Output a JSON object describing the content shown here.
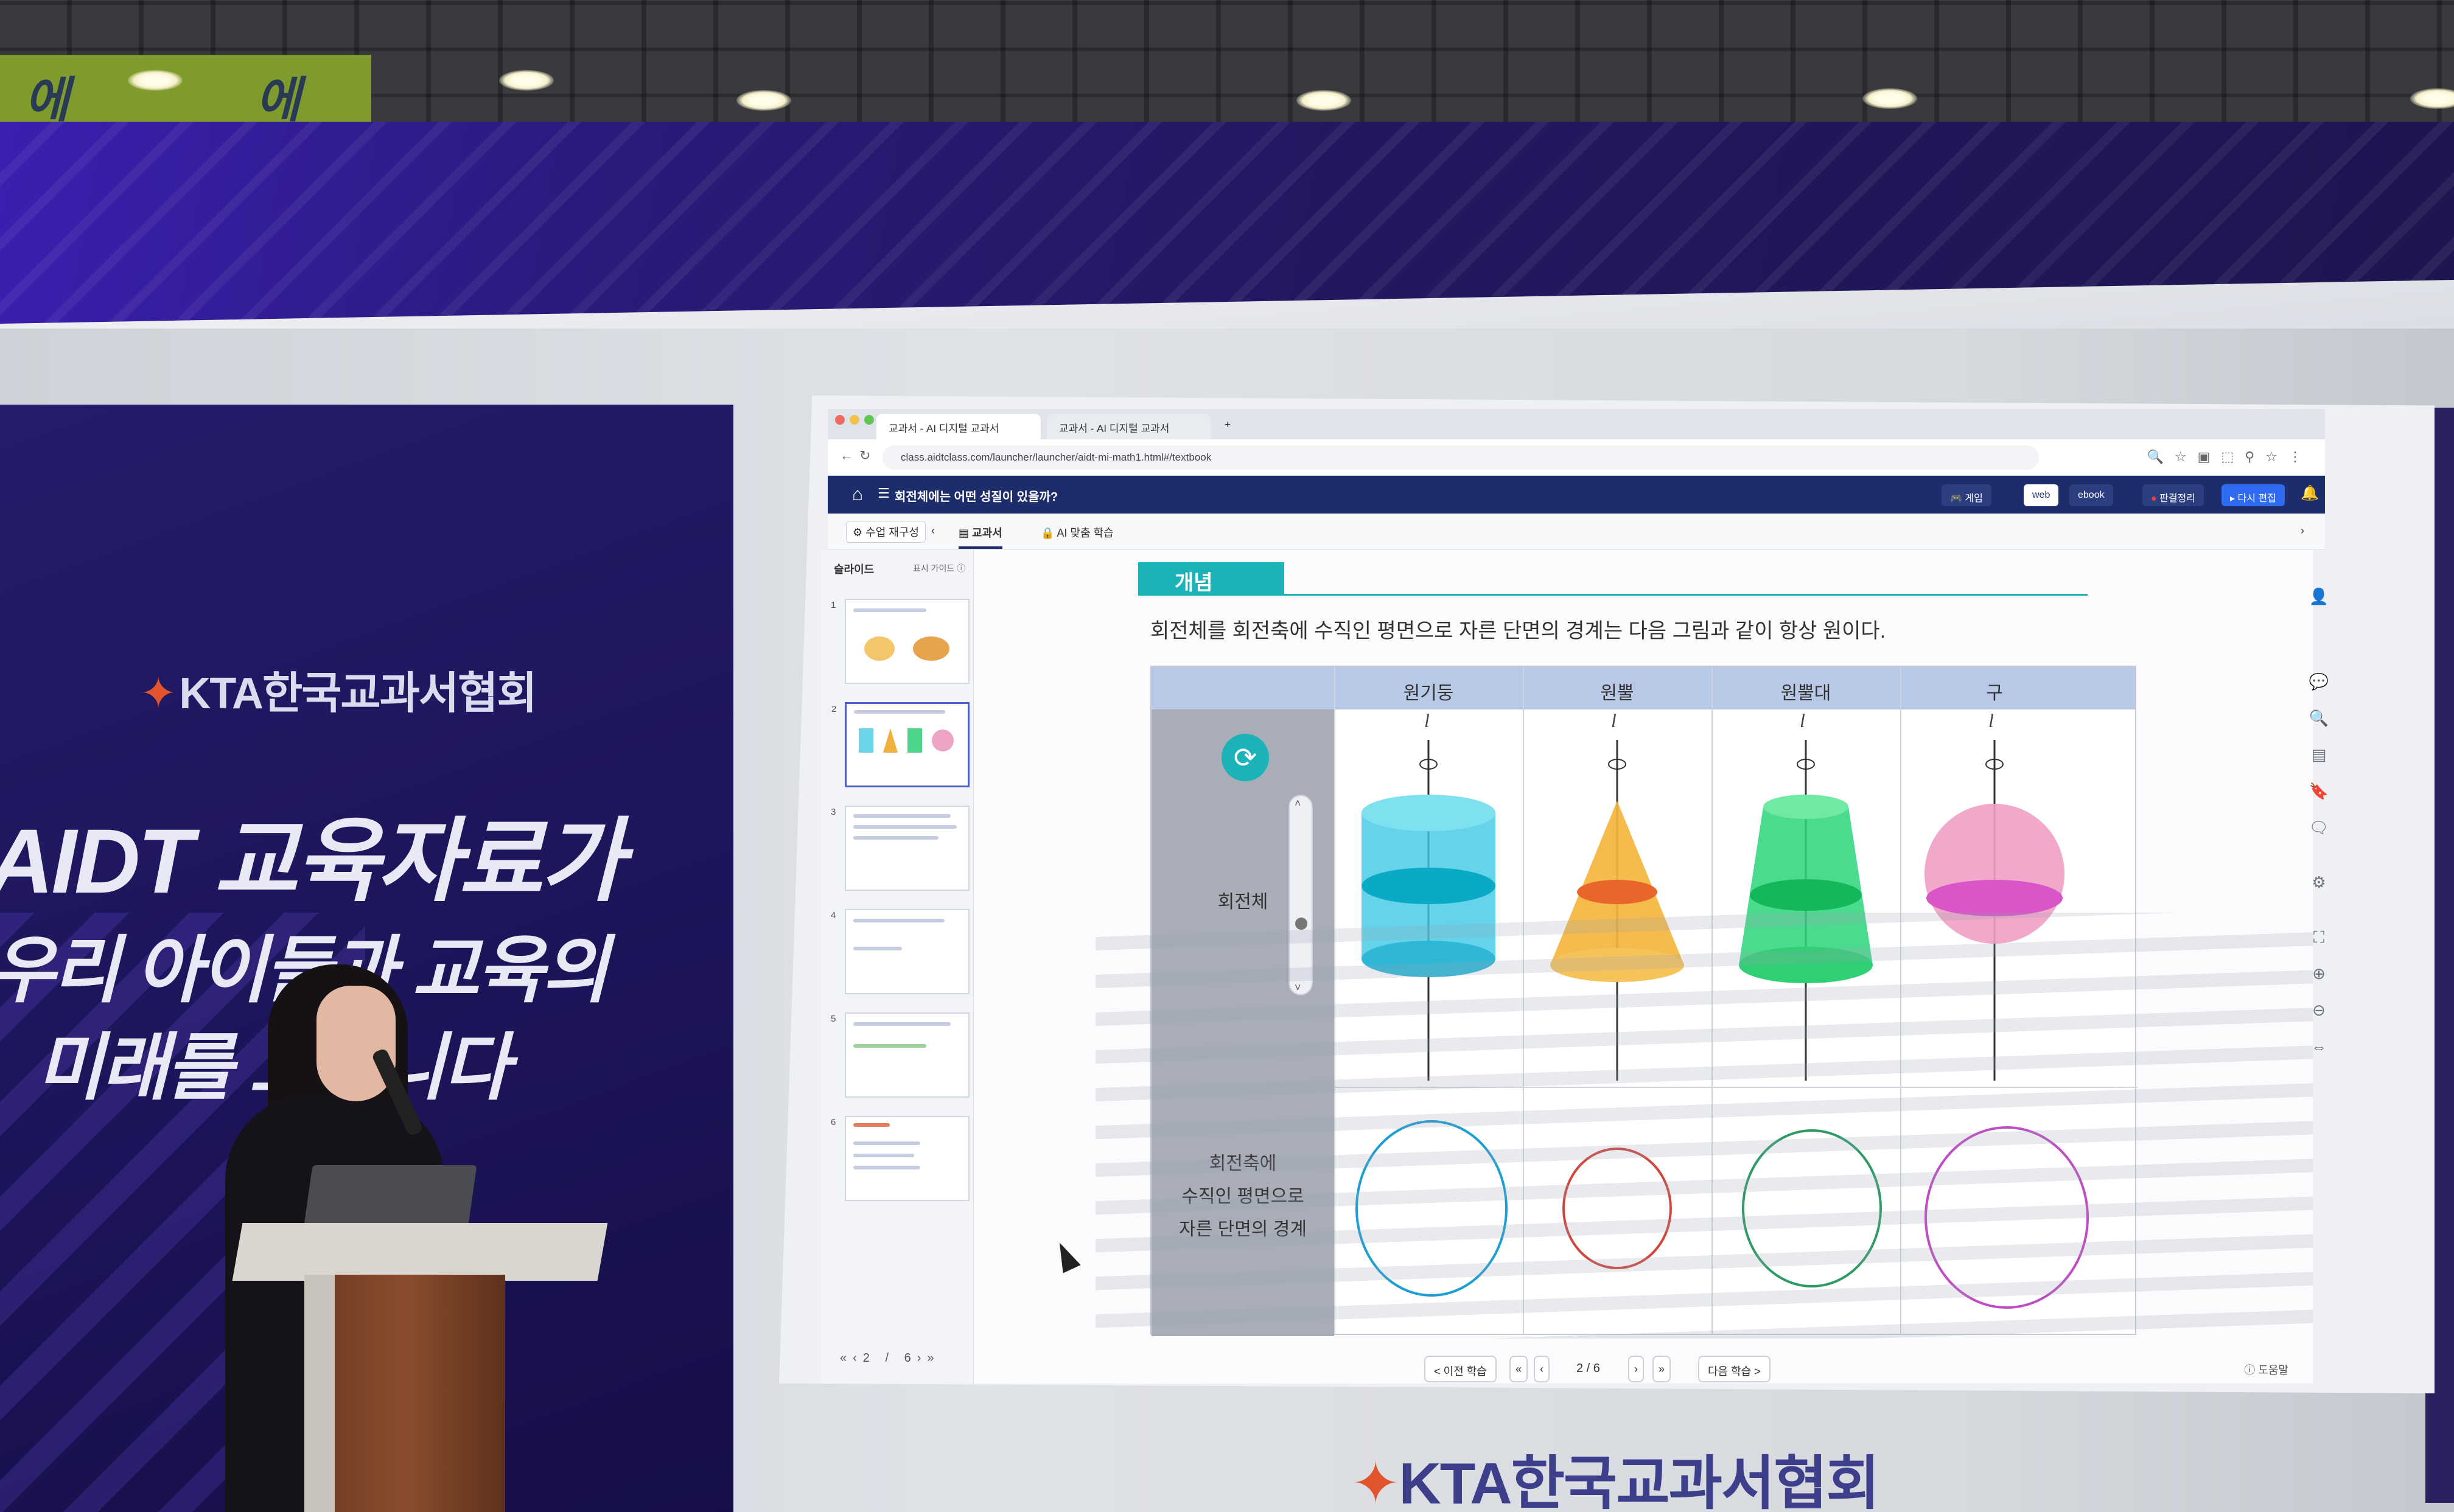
{
  "venue": {
    "ceiling_sign": [
      "에",
      "에"
    ],
    "banner": {
      "logo": "KTA한국교과서협회",
      "headline": [
        "AIDT 교육자료가",
        "우리 아이들과 교육의",
        "미래를 그립니다"
      ]
    },
    "bottom_logo": "KTA한국교과서협회"
  },
  "browser": {
    "tabs": [
      {
        "label": "교과서 - AI 디지털 교과서",
        "active": true
      },
      {
        "label": "교과서 - AI 디지털 교과서",
        "active": false
      }
    ],
    "new_tab": "+",
    "url": "class.aidtclass.com/launcher/launcher/aidt-mi-math1.html#/textbook"
  },
  "app": {
    "title": "회전체에는 어떤 성질이 있을까?",
    "header_buttons": {
      "game": "게임",
      "web": "web",
      "ebook": "ebook",
      "record": "판결정리",
      "replay": "다시 편집"
    },
    "subnav": {
      "class_reconfig": "수업 재구성",
      "textbook": "교과서",
      "ai_learning": "AI 맞춤 학습"
    },
    "slides": {
      "header": "슬라이드",
      "guide": "표시 가이드",
      "numbers": [
        "1",
        "2",
        "3",
        "4",
        "5",
        "6"
      ],
      "active_index": 2,
      "pager": "2 / 6"
    },
    "lesson": {
      "tag": "개념",
      "description": "회전체를 회전축에 수직인 평면으로 자른 단면의 경계는 다음 그림과 같이 항상 원이다.",
      "columns": [
        "원기둥",
        "원뿔",
        "원뿔대",
        "구"
      ],
      "axis_label": "l",
      "row_labels": {
        "solid": "회전체",
        "section": [
          "회전축에",
          "수직인 평면으로",
          "자른 단면의 경계"
        ]
      },
      "colors": {
        "cylinder": "#16b8d8",
        "cone": "#f0a52a",
        "frustum": "#22c96a",
        "sphere": "#e88ab6",
        "ring_cylinder": "#1a9fd0",
        "ring_cone": "#d2453a",
        "ring_frustum": "#2e9a64",
        "ring_sphere": "#c04cc4"
      }
    },
    "bottom_nav": {
      "prev": "< 이전 학습",
      "page": "2 / 6",
      "next": "다음 학습 >",
      "help": "도움말"
    }
  }
}
